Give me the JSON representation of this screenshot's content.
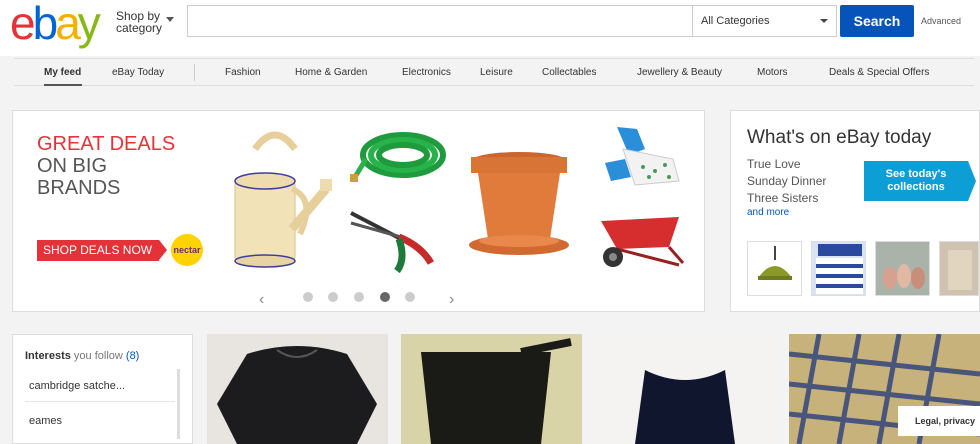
{
  "header": {
    "logo_letters": [
      {
        "ch": "e",
        "color": "#e53238"
      },
      {
        "ch": "b",
        "color": "#0064d2"
      },
      {
        "ch": "a",
        "color": "#f5af02"
      },
      {
        "ch": "y",
        "color": "#86b817"
      }
    ],
    "shop_by_line1": "Shop by",
    "shop_by_line2": "category",
    "search_placeholder": "",
    "category_selected": "All Categories",
    "search_button": "Search",
    "advanced_link": "Advanced"
  },
  "nav": {
    "items": [
      {
        "label": "My feed"
      },
      {
        "label": "eBay Today"
      },
      {
        "label": "Fashion"
      },
      {
        "label": "Home & Garden"
      },
      {
        "label": "Electronics"
      },
      {
        "label": "Leisure"
      },
      {
        "label": "Collectables"
      },
      {
        "label": "Jewellery & Beauty"
      },
      {
        "label": "Motors"
      },
      {
        "label": "Deals & Special Offers"
      }
    ]
  },
  "promo": {
    "line1": "GREAT DEALS",
    "line2": "ON BIG",
    "line3": "BRANDS",
    "button": "SHOP DEALS NOW",
    "nectar": "nectar"
  },
  "carousel": {
    "prev": "‹",
    "next": "›",
    "dots": 5,
    "active_dot": 4
  },
  "today": {
    "title": "What's on eBay today",
    "items": [
      "True Love",
      "Sunday Dinner",
      "Three Sisters"
    ],
    "more": "and more",
    "button_line1": "See today's",
    "button_line2": "collections"
  },
  "interests": {
    "heading": "Interests",
    "sub": "you follow",
    "count": "(8)",
    "items": [
      "cambridge satche...",
      "eames"
    ]
  },
  "footer": {
    "legal": "Legal, privacy"
  },
  "colors": {
    "search_blue": "#0654ba",
    "promo_red": "#e53238",
    "collections_blue": "#0d9ed6"
  }
}
